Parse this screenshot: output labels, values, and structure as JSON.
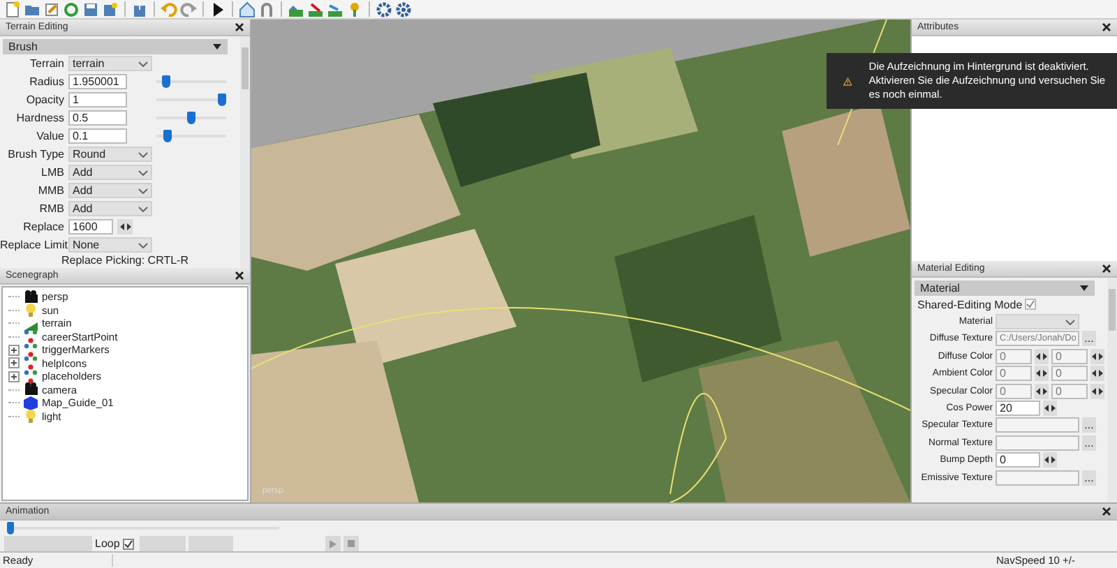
{
  "terrain_editing": {
    "title": "Terrain Editing",
    "section": "Brush",
    "rows": [
      {
        "kind": "dropdown",
        "label": "Terrain",
        "value": "terrain"
      },
      {
        "kind": "slider",
        "label": "Radius",
        "value": "1.950001",
        "level": 0.08
      },
      {
        "kind": "slider",
        "label": "Opacity",
        "value": "1",
        "level": 1
      },
      {
        "kind": "slider",
        "label": "Hardness",
        "value": "0.5",
        "level": 0.5
      },
      {
        "kind": "slider",
        "label": "Value",
        "value": "0.1",
        "level": 0.12
      },
      {
        "kind": "dropdown",
        "label": "Brush Type",
        "value": "Round"
      },
      {
        "kind": "dropdown",
        "label": "LMB",
        "value": "Add"
      },
      {
        "kind": "dropdown",
        "label": "MMB",
        "value": "Add"
      },
      {
        "kind": "dropdown",
        "label": "RMB",
        "value": "Add"
      },
      {
        "kind": "spinner",
        "label": "Replace",
        "value": "1600"
      },
      {
        "kind": "dropdown",
        "label": "Replace Limit",
        "value": "None"
      }
    ],
    "note": "Replace Picking: CRTL-R"
  },
  "scenegraph": {
    "title": "Scenegraph",
    "items": [
      {
        "label": "persp",
        "kind": "camera"
      },
      {
        "label": "sun",
        "kind": "light"
      },
      {
        "label": "terrain",
        "kind": "terrain"
      },
      {
        "label": "careerStartPoint",
        "kind": "group"
      },
      {
        "label": "triggerMarkers",
        "kind": "group",
        "expanded": false
      },
      {
        "label": "helpIcons",
        "kind": "group",
        "expanded": false
      },
      {
        "label": "placeholders",
        "kind": "group",
        "expanded": false
      },
      {
        "label": "camera",
        "kind": "camera"
      },
      {
        "label": "Map_Guide_01",
        "kind": "mesh"
      },
      {
        "label": "light",
        "kind": "light"
      }
    ]
  },
  "viewport": {
    "label": "persp"
  },
  "attributes": {
    "title": "Attributes"
  },
  "notification": {
    "message": "Die Aufzeichnung im Hintergrund ist deaktiviert. Aktivieren Sie die Aufzeichnung und versuchen Sie es noch einmal."
  },
  "material_editing": {
    "title": "Material Editing",
    "section": "Material",
    "rows": [
      {
        "kind": "checkbox",
        "label": "Shared-Editing Mode",
        "checked": true
      },
      {
        "kind": "dropdown",
        "label": "Material"
      },
      {
        "kind": "texture",
        "label": "Diffuse Texture",
        "value": "C:/Users/Jonah/Do",
        "button": "..."
      },
      {
        "kind": "color",
        "label": "Diffuse Color",
        "values": [
          "0",
          "0"
        ]
      },
      {
        "kind": "color",
        "label": "Ambient Color",
        "values": [
          "0",
          "0"
        ]
      },
      {
        "kind": "color",
        "label": "Specular Color",
        "values": [
          "0",
          "0"
        ]
      },
      {
        "kind": "spinner",
        "label": "Cos Power",
        "value": "20"
      },
      {
        "kind": "texture",
        "label": "Specular Texture",
        "button": "..."
      },
      {
        "kind": "texture",
        "label": "Normal Texture",
        "button": "..."
      },
      {
        "kind": "spinner",
        "label": "Bump Depth",
        "value": "0"
      },
      {
        "kind": "texture",
        "label": "Emissive Texture",
        "button": "..."
      }
    ]
  },
  "animation": {
    "title": "Animation",
    "level": 0,
    "loop": {
      "label": "Loop",
      "checked": true
    }
  },
  "status_bar": {
    "left": "Ready",
    "right": "NavSpeed 10 +/-"
  }
}
